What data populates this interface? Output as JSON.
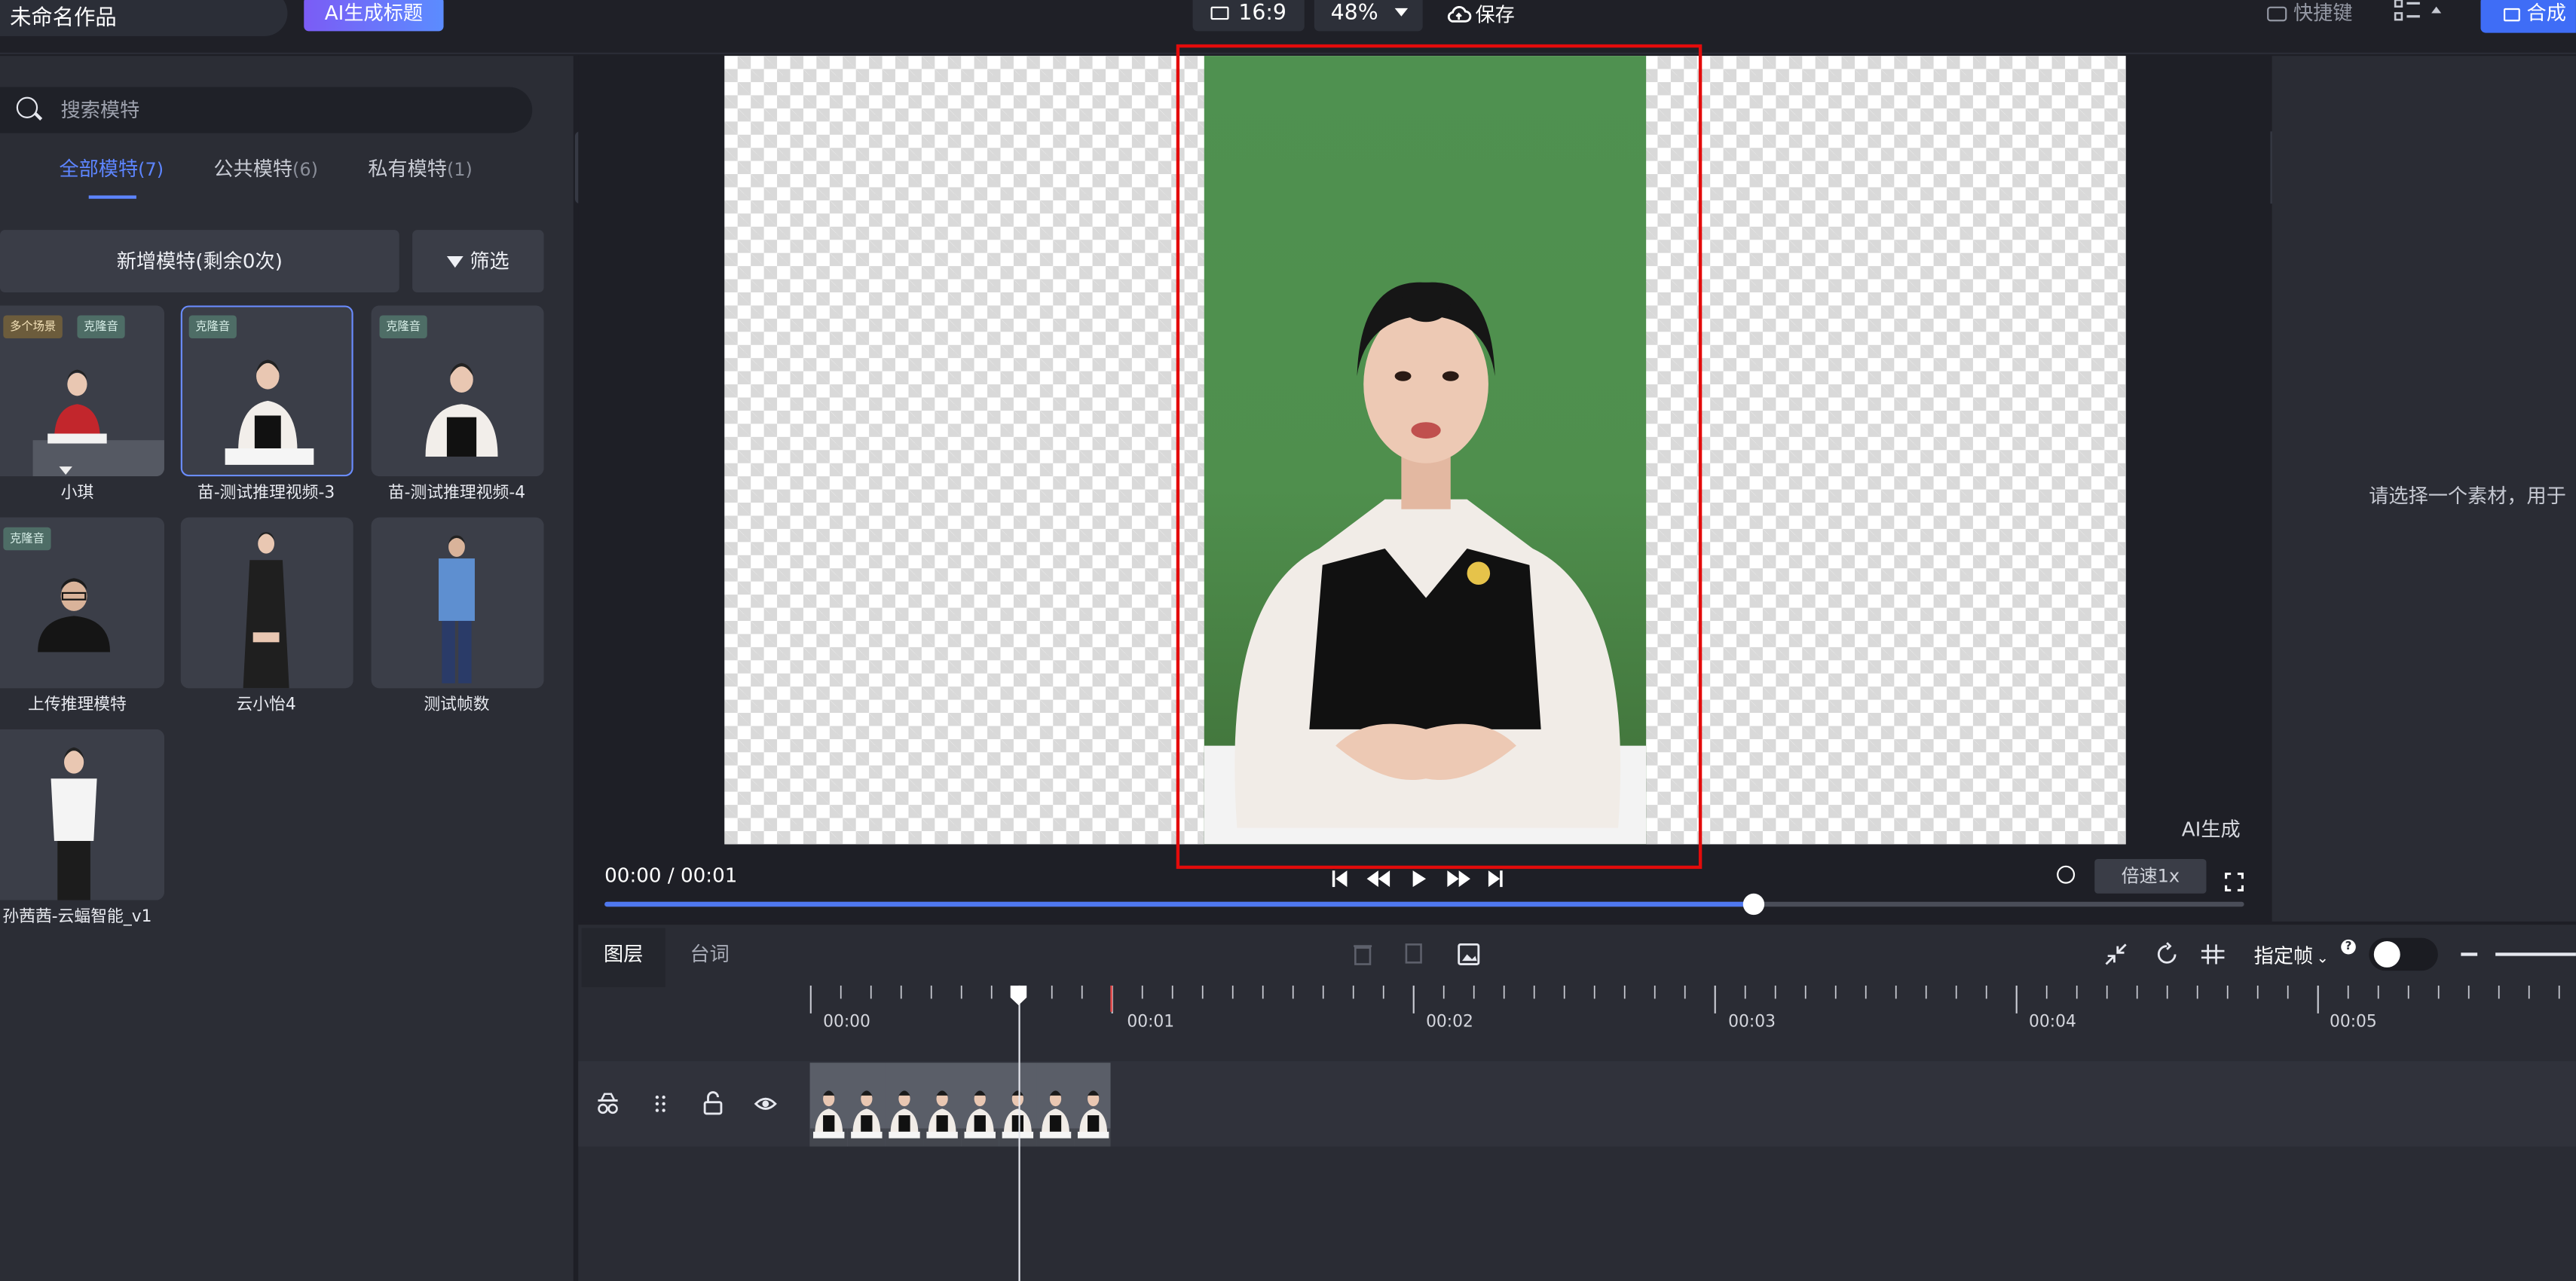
{
  "header": {
    "project_name": "未命名作品",
    "ai_title_button": "AI生成标题",
    "aspect_ratio": "16:9",
    "zoom": "48%",
    "save_label": "保存",
    "shortcuts_label": "快捷键",
    "compose_label": "合成"
  },
  "sidebar": {
    "search_placeholder": "搜索模特",
    "tabs": [
      {
        "label": "全部模特",
        "count": "(7)"
      },
      {
        "label": "公共模特",
        "count": "(6)"
      },
      {
        "label": "私有模特",
        "count": "(1)"
      }
    ],
    "add_button": "新增模特(剩余0次)",
    "filter_button": "筛选",
    "models": [
      {
        "name": "小琪",
        "tags": [
          "多个场景",
          "克隆音"
        ]
      },
      {
        "name": "苗-测试推理视频-3",
        "tags": [
          "克隆音"
        ]
      },
      {
        "name": "苗-测试推理视频-4",
        "tags": [
          "克隆音"
        ]
      },
      {
        "name": "上传推理模特",
        "tags": [
          "克隆音"
        ]
      },
      {
        "name": "云小怡4",
        "tags": []
      },
      {
        "name": "测试帧数",
        "tags": []
      },
      {
        "name": "孙茜茜-云蝠智能_v1",
        "tags": []
      }
    ]
  },
  "preview": {
    "watermark": "AI生成",
    "time_display": "00:00 / 00:01",
    "speed_label": "倍速1x",
    "progress": 0.7
  },
  "right_panel": {
    "hint": "请选择一个素材，用于"
  },
  "timeline": {
    "tabs": [
      "图层",
      "台词"
    ],
    "keyframe_label": "指定帧",
    "ticks": [
      "00:00",
      "00:01",
      "00:02",
      "00:03",
      "00:04",
      "00:05"
    ]
  },
  "colors": {
    "accent": "#5d85ff",
    "compose": "#3f6df6",
    "highlight_box": "#e30b0b",
    "green_screen": "#4f9150"
  }
}
